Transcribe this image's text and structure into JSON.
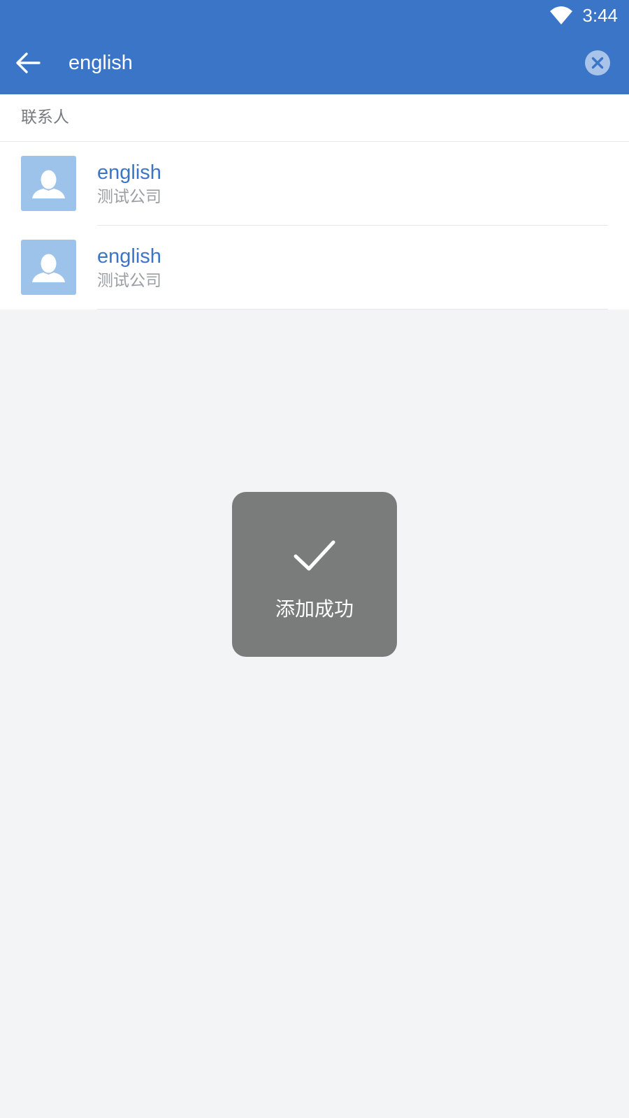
{
  "status_bar": {
    "time": "3:44",
    "wifi_icon": "wifi-icon"
  },
  "search_bar": {
    "back_icon": "arrow-left-icon",
    "query": "english",
    "clear_icon": "clear-circle-icon"
  },
  "section": {
    "title": "联系人"
  },
  "results": [
    {
      "name": "english",
      "company": "测试公司",
      "avatar_icon": "person-icon"
    },
    {
      "name": "english",
      "company": "测试公司",
      "avatar_icon": "person-icon"
    }
  ],
  "toast": {
    "icon": "checkmark-icon",
    "message": "添加成功"
  },
  "colors": {
    "primary": "#3a75c8",
    "avatar_bg": "#9ec3ea",
    "toast_bg": "#7a7b7b",
    "page_bg": "#f3f4f6"
  }
}
